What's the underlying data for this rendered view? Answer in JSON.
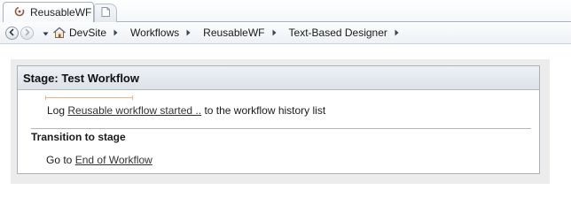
{
  "tabs": [
    {
      "label": "ReusableWF",
      "icon": "sharepoint-spinner-icon",
      "active": true
    },
    {
      "label": "",
      "icon": "new-tab-icon",
      "active": false
    }
  ],
  "nav": {
    "back_icon": "back-arrow-icon",
    "forward_icon": "forward-arrow-icon",
    "menu_icon": "dropdown-chevron-icon",
    "home_icon": "home-icon",
    "breadcrumbs": [
      "DevSite",
      "Workflows",
      "ReusableWF",
      "Text-Based Designer"
    ]
  },
  "designer": {
    "stage_title": "Stage: Test Workflow",
    "action": {
      "prefix": "Log",
      "link": "Reusable workflow started ..",
      "suffix": "to the workflow history list"
    },
    "transition_title": "Transition to stage",
    "goto": {
      "prefix": "Go to",
      "link": "End of Workflow"
    }
  },
  "colors": {
    "insertion_marker": "#f4b183",
    "header_bg": "#dde2e8",
    "canvas_bg": "#ececec"
  }
}
